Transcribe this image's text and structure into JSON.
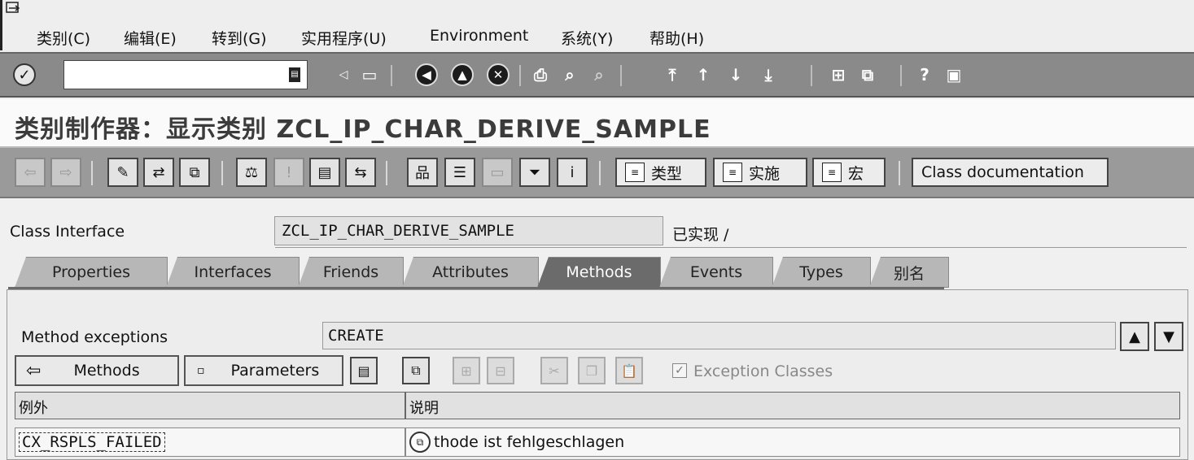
{
  "menu": {
    "items": [
      "类别(C)",
      "编辑(E)",
      "转到(G)",
      "实用程序(U)",
      "Environment",
      "系统(Y)",
      "帮助(H)"
    ]
  },
  "page_title": "类别制作器：显示类别 ZCL_IP_CHAR_DERIVE_SAMPLE",
  "app_toolbar": {
    "type_button": "类型",
    "impl_button": "实施",
    "macro_button": "宏",
    "class_doc_button": "Class documentation"
  },
  "class_interface": {
    "label": "Class Interface",
    "value": "ZCL_IP_CHAR_DERIVE_SAMPLE",
    "status": "已实现 /"
  },
  "tabs": [
    "Properties",
    "Interfaces",
    "Friends",
    "Attributes",
    "Methods",
    "Events",
    "Types",
    "别名"
  ],
  "active_tab": "Methods",
  "method_exceptions": {
    "label": "Method exceptions",
    "value": "CREATE"
  },
  "method_toolbar": {
    "methods_button": "Methods",
    "parameters_button": "Parameters",
    "exception_classes_label": "Exception Classes",
    "exception_classes_checked": true
  },
  "table": {
    "columns": [
      "例外",
      "说明"
    ],
    "rows": [
      {
        "exception": "CX_RSPLS_FAILED",
        "description": "thode ist fehlgeschlagen"
      }
    ]
  },
  "colors": {
    "toolbar_bg": "#8a8a8a",
    "app_toolbar_bg": "#9a9a9a",
    "active_tab_bg": "#6b6b6b"
  }
}
